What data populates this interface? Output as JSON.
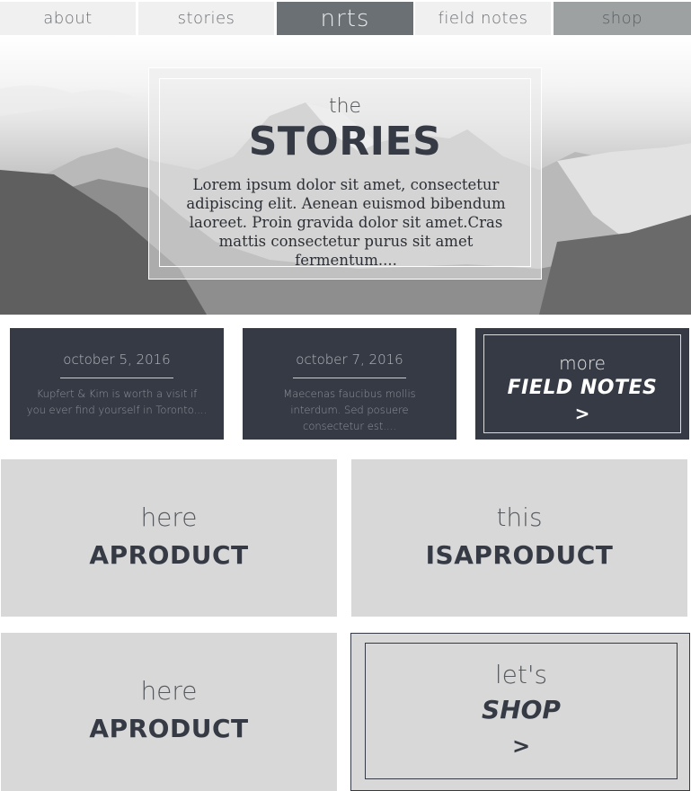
{
  "nav": {
    "items": [
      {
        "label": "about"
      },
      {
        "label": "stories"
      },
      {
        "label": "NRTS"
      },
      {
        "label": "field notes"
      },
      {
        "label": "shop"
      }
    ]
  },
  "hero": {
    "kicker": "the",
    "title": "STORIES",
    "text": "Lorem ipsum dolor sit amet, consectetur adipiscing elit. Aenean euismod bibendum laoreet. Proin gravida dolor sit amet.Cras mattis consectetur purus sit amet fermentum...."
  },
  "notes": [
    {
      "date": "october 5, 2016",
      "excerpt": "Kupfert & Kim is worth a visit if you ever find yourself in Toronto...."
    },
    {
      "date": "october 7, 2016",
      "excerpt": "Maecenas faucibus mollis interdum. Sed posuere consectetur est...."
    }
  ],
  "more": {
    "word": "more",
    "title": "FIELD NOTES",
    "arrow": ">"
  },
  "products": [
    {
      "word": "here",
      "title": "APRODUCT"
    },
    {
      "word": "this",
      "title": "ISAPRODUCT"
    },
    {
      "word": "here",
      "title": "APRODUCT"
    }
  ],
  "shop": {
    "word": "let's",
    "title": "SHOP",
    "arrow": ">"
  },
  "colors": {
    "dark": "#353a44",
    "tile": "#d8d8d8",
    "brand": "#6b7074"
  }
}
